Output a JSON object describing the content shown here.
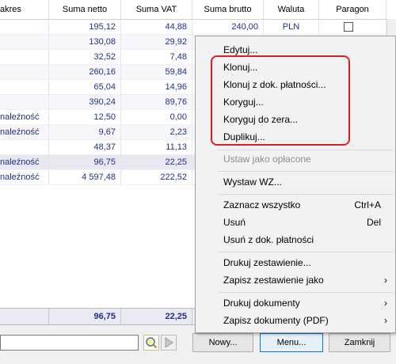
{
  "table": {
    "columns": [
      "akres",
      "Suma netto",
      "Suma VAT",
      "Suma brutto",
      "Waluta",
      "Paragon"
    ],
    "rows": [
      {
        "c0": "",
        "net": "195,12",
        "vat": "44,88",
        "gross": "240,00",
        "cur": "PLN"
      },
      {
        "c0": "",
        "net": "130,08",
        "vat": "29,92",
        "gross": "",
        "cur": ""
      },
      {
        "c0": "",
        "net": "32,52",
        "vat": "7,48",
        "gross": "",
        "cur": ""
      },
      {
        "c0": "",
        "net": "260,16",
        "vat": "59,84",
        "gross": "",
        "cur": ""
      },
      {
        "c0": "",
        "net": "65,04",
        "vat": "14,96",
        "gross": "",
        "cur": ""
      },
      {
        "c0": "",
        "net": "390,24",
        "vat": "89,76",
        "gross": "",
        "cur": ""
      },
      {
        "c0": "naleźność",
        "net": "12,50",
        "vat": "0,00",
        "gross": "",
        "cur": ""
      },
      {
        "c0": "naleźność",
        "net": "9,67",
        "vat": "2,23",
        "gross": "",
        "cur": ""
      },
      {
        "c0": "",
        "net": "48,37",
        "vat": "11,13",
        "gross": "",
        "cur": ""
      },
      {
        "c0": "naleźność",
        "net": "96,75",
        "vat": "22,25",
        "gross": "",
        "cur": ""
      },
      {
        "c0": "naleźność",
        "net": "4 597,48",
        "vat": "222,52",
        "gross": "",
        "cur": ""
      }
    ],
    "totals": {
      "net": "96,75",
      "vat": "22,25"
    }
  },
  "buttons": {
    "new_label": "Nowy...",
    "menu_label": "Menu...",
    "close_label": "Zamknij"
  },
  "search": {
    "value": ""
  },
  "menu": {
    "edit": "Edytuj...",
    "clone": "Klonuj...",
    "clone_payment": "Klonuj z dok. płatności...",
    "correct": "Koryguj...",
    "correct_zero": "Koryguj do zera...",
    "duplicate": "Duplikuj...",
    "set_paid": "Ustaw jako opłacone",
    "issue_wz": "Wystaw WZ...",
    "select_all": "Zaznacz wszystko",
    "select_all_shortcut": "Ctrl+A",
    "delete": "Usuń",
    "delete_shortcut": "Del",
    "delete_payment": "Usuń z dok. płatności",
    "print_summary": "Drukuj zestawienie...",
    "save_summary_as": "Zapisz zestawienie jako",
    "print_documents": "Drukuj dokumenty",
    "save_documents_pdf": "Zapisz dokumenty (PDF)"
  },
  "colors": {
    "highlight": "#e31b23",
    "data_text": "#1f2f8f"
  }
}
